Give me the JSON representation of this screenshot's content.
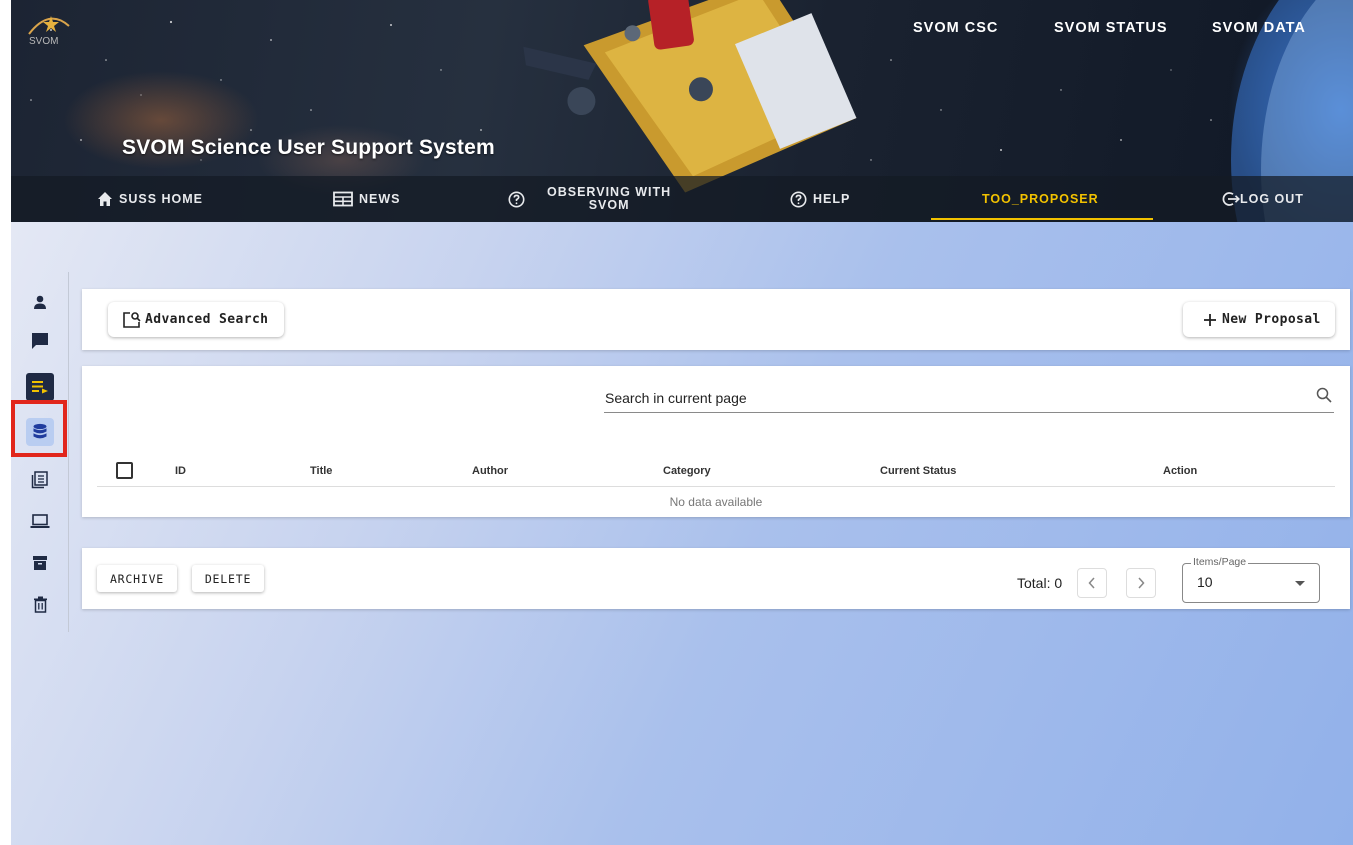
{
  "header": {
    "logo_text": "SVOM",
    "site_title": "SVOM Science User Support System",
    "top_links": [
      "SVOM CSC",
      "SVOM STATUS",
      "SVOM DATA"
    ],
    "nav": {
      "home": "SUSS HOME",
      "news": "NEWS",
      "observing_line1": "OBSERVING WITH",
      "observing_line2": "SVOM",
      "help": "HELP",
      "user": "TOO_PROPOSER",
      "logout": "LOG OUT"
    }
  },
  "sidebar": {
    "icons": [
      "person-icon",
      "chat-icon",
      "playlist-icon",
      "database-icon",
      "document-list-icon",
      "laptop-icon",
      "archive-icon",
      "trash-icon"
    ],
    "selected": "database-icon",
    "highlight_color": "#e1261c"
  },
  "toolbar": {
    "advanced_search_label": "Advanced Search",
    "new_proposal_label": "New Proposal"
  },
  "table": {
    "search_placeholder": "Search in current page",
    "columns": [
      "ID",
      "Title",
      "Author",
      "Category",
      "Current Status",
      "Action"
    ],
    "rows": [],
    "empty_text": "No data available"
  },
  "footer": {
    "archive_label": "ARCHIVE",
    "delete_label": "DELETE",
    "total_text": "Total: 0",
    "items_per_page_label": "Items/Page",
    "items_per_page_value": "10"
  },
  "colors": {
    "accent": "#f2c200",
    "nav_dark": "#1f2a44",
    "selected_bg": "#b9cdf1"
  }
}
